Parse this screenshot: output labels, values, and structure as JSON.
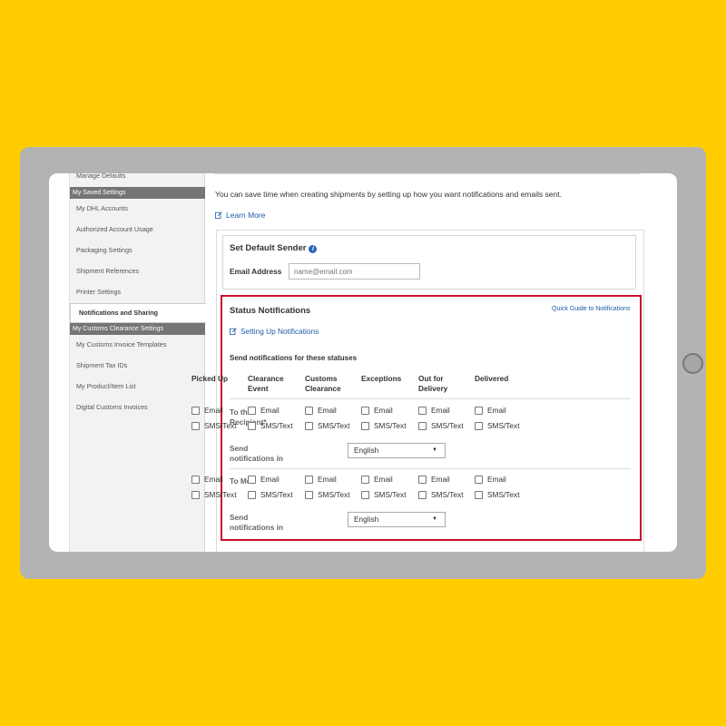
{
  "sidebar": {
    "items": [
      {
        "label": "Manage Defaults",
        "type": "item"
      },
      {
        "label": "My Saved Settings",
        "type": "header"
      },
      {
        "label": "My DHL Accounts",
        "type": "item"
      },
      {
        "label": "Authorized Account Usage",
        "type": "item"
      },
      {
        "label": "Packaging Settings",
        "type": "item"
      },
      {
        "label": "Shipment References",
        "type": "item"
      },
      {
        "label": "Printer Settings",
        "type": "item"
      },
      {
        "label": "Notifications and Sharing",
        "type": "active"
      },
      {
        "label": "My Customs Clearance Settings",
        "type": "header"
      },
      {
        "label": "My Customs Invoice Templates",
        "type": "item"
      },
      {
        "label": "Shipment Tax IDs",
        "type": "item"
      },
      {
        "label": "My Product/Item List",
        "type": "item"
      },
      {
        "label": "Digital Customs Invoices",
        "type": "item"
      }
    ]
  },
  "main": {
    "intro_text": "You can save time when creating shipments by setting up how you want notifications and emails sent.",
    "learn_more": "Learn More",
    "sender": {
      "title": "Set Default Sender",
      "info_icon": "i",
      "email_label": "Email Address",
      "email_placeholder": "name@email.com",
      "email_value": ""
    },
    "status": {
      "title": "Status Notifications",
      "quick_guide": "Quick Guide to Notifications",
      "setup_link": "Setting Up Notifications",
      "send_statuses": "Send notifications for these statuses",
      "columns": [
        [
          "Picked Up"
        ],
        [
          "Clearance",
          "Event"
        ],
        [
          "Customs",
          "Clearance"
        ],
        [
          "Exceptions"
        ],
        [
          "Out for",
          "Delivery"
        ],
        [
          "Delivered"
        ]
      ],
      "rows": [
        {
          "label": [
            "To the",
            "Recipient*"
          ],
          "send_label": [
            "Send",
            "notifications in"
          ],
          "language": "English"
        },
        {
          "label": [
            "To Me"
          ],
          "send_label": [
            "Send",
            "notifications in"
          ],
          "language": "English"
        }
      ],
      "option_email": "Email",
      "option_sms": "SMS/Text"
    }
  },
  "colors": {
    "background": "#FFCC00",
    "device": "#B3B3B3",
    "highlight": "#C8102E",
    "link": "#1E5AA8",
    "sidebar_header": "#757575"
  }
}
